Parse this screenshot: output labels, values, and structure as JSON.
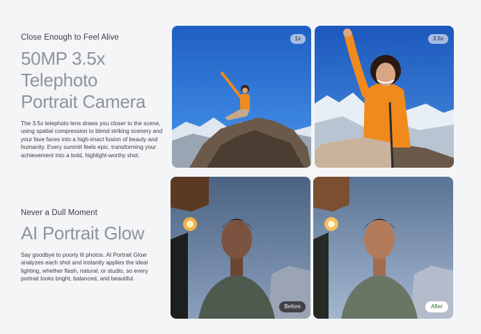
{
  "section1": {
    "eyebrow": "Close Enough to Feel Alive",
    "headline_lines": [
      "50MP 3.5x",
      "Telephoto",
      "Portrait Camera"
    ],
    "body": "The 3.5x telephoto lens draws you closer to the scene, using spatial compression to blend striking scenery and your fave faces into a high-imact fusion of beauty and humanity. Every summit feels epic, transforming your achievement into a bold, highlight-worthy shot.",
    "photo_left_badge": "1x",
    "photo_right_badge": "3.5x"
  },
  "section2": {
    "eyebrow": "Never a Dull Moment",
    "headline": "AI Portrait Glow",
    "body": "Say goodbye to poorly lit photos. AI Portrait Glow analyzes each shot and instantly applies the ideal lighting, whether flash, natural, or studio, so every portrait looks bright, balanced, and beautiful.",
    "photo_left_badge": "Before",
    "photo_right_badge": "After"
  },
  "colors": {
    "background": "#f4f5f7",
    "headline": "#8f939b",
    "body_text": "#3a3c42",
    "after_badge_text": "#2a6b2a"
  }
}
